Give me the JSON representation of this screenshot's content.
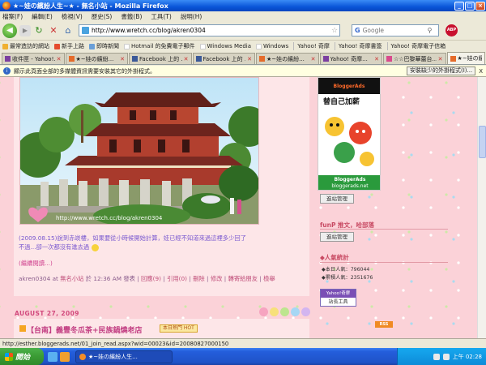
{
  "window": {
    "title": "★~娃の繽紛人生~★ - 無名小站 - Mozilla Firefox"
  },
  "menu": [
    "檔案(F)",
    "編輯(E)",
    "檢視(V)",
    "歷史(S)",
    "書籤(B)",
    "工具(T)",
    "說明(H)"
  ],
  "nav": {
    "url": "http://www.wretch.cc/blog/akren0304",
    "search_placeholder": "Google",
    "search_engine": "G",
    "adblock_label": "ABP"
  },
  "bookmarks": [
    "最常造訪的網站",
    "新手上路",
    "即時新聞",
    "Hotmail 的免費電子郵件",
    "Windows Media",
    "Windows",
    "Yahoo! 奇摩",
    "Yahoo! 奇摩書簽",
    "Yahoo! 奇摩電子信箱"
  ],
  "tabs": [
    {
      "label": "收件匣 - Yahoo!...",
      "active": false
    },
    {
      "label": "★~娃の繽紛...",
      "active": false
    },
    {
      "label": "Facebook 上的 ...",
      "active": false
    },
    {
      "label": "Facebook 上的 ...",
      "active": false
    },
    {
      "label": "★~娃の繽紛...",
      "active": false
    },
    {
      "label": "Yahoo! 奇摩...",
      "active": false
    },
    {
      "label": "☆☆巴黎華蕾台...",
      "active": false
    },
    {
      "label": "★~娃の繽紛...",
      "active": true
    }
  ],
  "notification": {
    "message": "顯示此頁面全部的多媒體資訊需要安裝其它的外掛程式。",
    "button": "安裝缺少的外掛程式(I)...",
    "close": "X"
  },
  "post": {
    "watermark": "http://www.wretch.cc/blog/akren0304",
    "caption_line1": "(2009.08.15)說到赤崁樓，如果要從小時候開始計算，娃已經不知道來過這裡多少回了",
    "caption_line2": "不過...卻一次都沒有進去過",
    "read_more": "(繼續閱讀...)",
    "author": "akren0304",
    "at": "at",
    "site": "無名小站",
    "on": "於",
    "time": "12:36 AM",
    "publish": "發表",
    "links": [
      "回應(9)",
      "引用(0)",
      "刪除",
      "修改",
      "轉寄給朋友",
      "檢舉"
    ]
  },
  "post2": {
    "date": "AUGUST 27, 2009",
    "title": "【台南】義豐冬瓜茶+民族鍋燒老店",
    "badge": "本日熱門 HOT"
  },
  "sidebar": {
    "ad_header": "BloggerAds",
    "ad_header_sub": "替自己加薪",
    "ad_footer": "BloggerAds",
    "ad_footer_sub": "bloggerads.net",
    "manage_label_1": "進站管理",
    "funp_heading": "funP 推文，哈部落",
    "manage_label_2": "進站管理",
    "stats_heading": "◆人氣統計",
    "stats_today": "◆本日人氣：796044",
    "stats_total": "◆累積人氣：2351676",
    "yahoo_label": "Yahoo!奇摩",
    "yahoo_sub": "站長工具",
    "rss_label": "RSS"
  },
  "status": {
    "url": "http://esther.bloggerads.net/01_join_read.aspx?wid=00023&id=20080827000150"
  },
  "taskbar": {
    "start": "開始",
    "task": "★~娃の繽紛人生...",
    "clock": "上午 02:28"
  },
  "colors": {
    "page_bg": "#fbd2d8",
    "post_bg": "#fde6e8",
    "accent": "#d24a7d",
    "link": "#7a5ad0"
  }
}
